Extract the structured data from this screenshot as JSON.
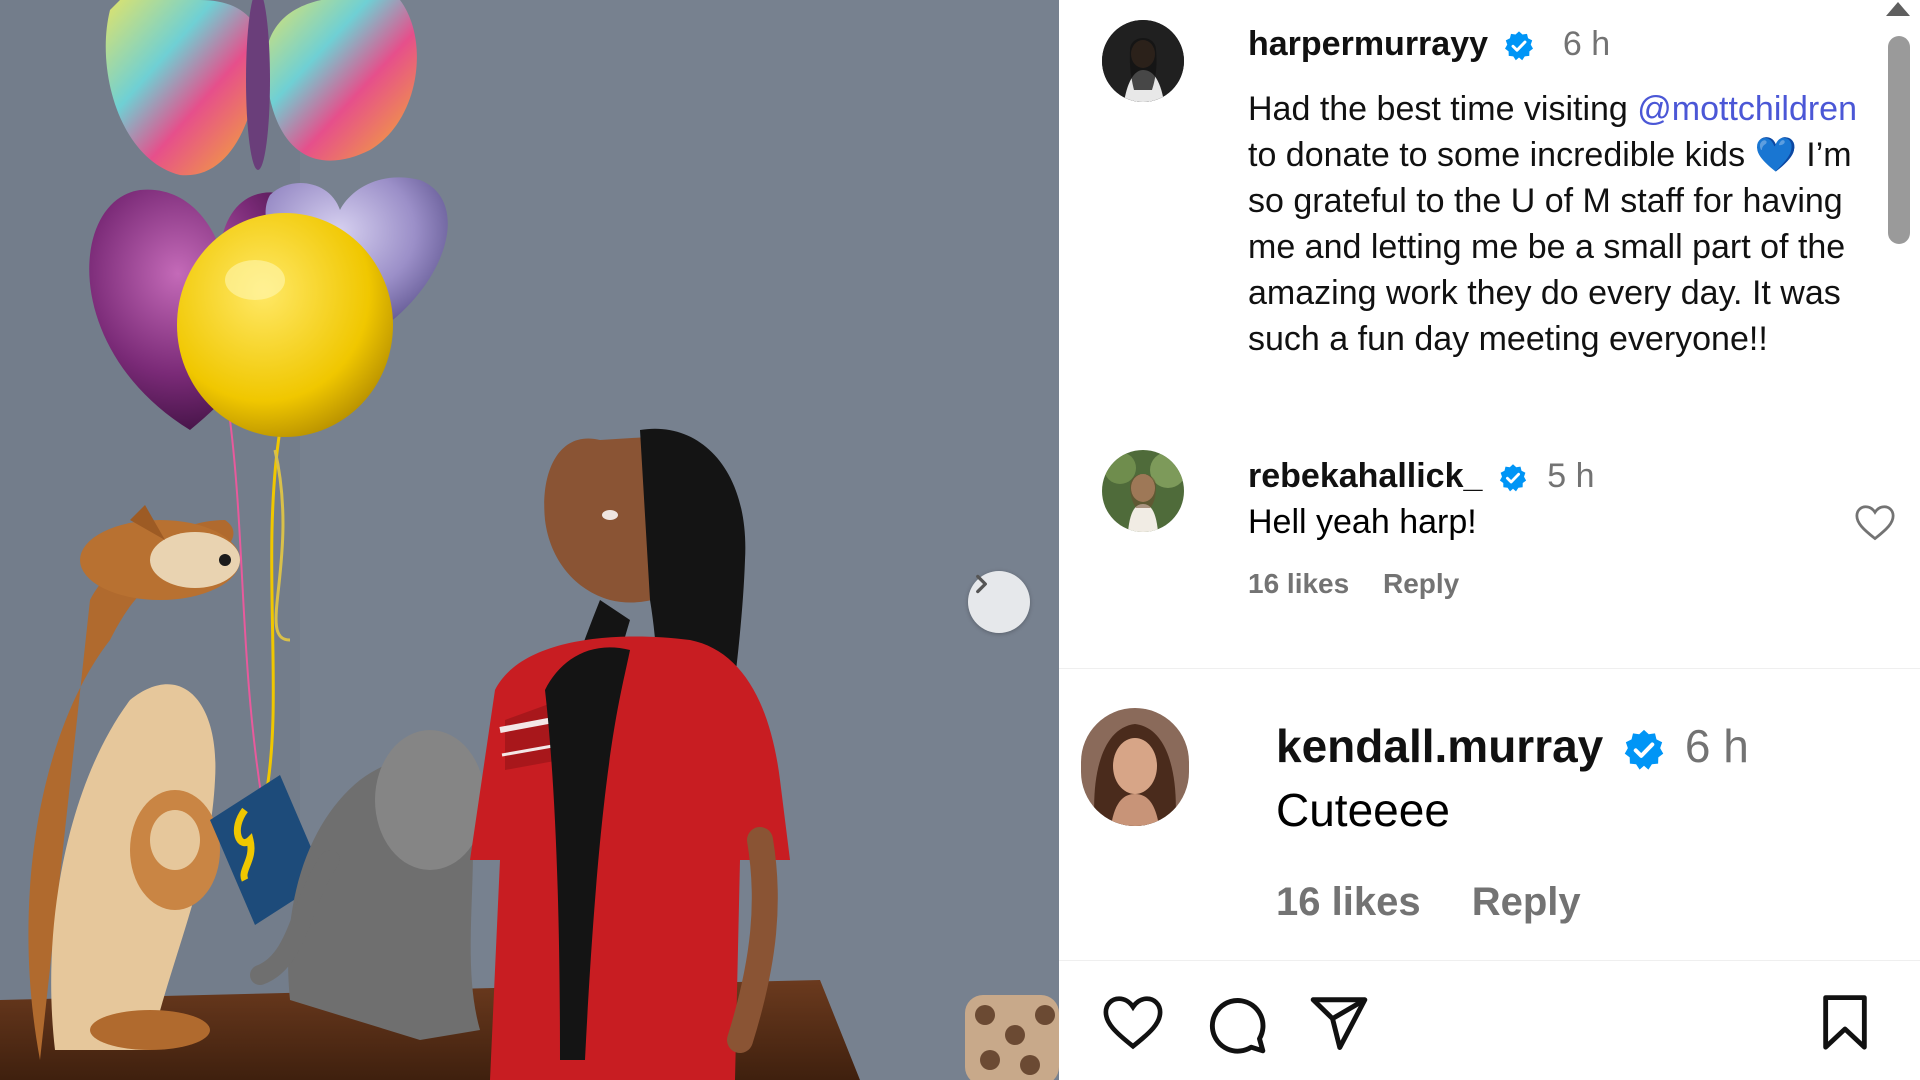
{
  "post": {
    "author": "harpermurrayy",
    "time": "6 h",
    "caption_parts": [
      "Had the best time visiting ",
      "@mottchildren",
      " to donate to some incredible kids ",
      "💙",
      " I’m so grateful to the U of M staff for having me and letting me be a small part of the amazing work they do every day. It was such a fun day meeting everyone!!"
    ]
  },
  "comments": [
    {
      "user": "rebekahallick_",
      "time": "5 h",
      "text": "Hell yeah harp!",
      "likes": "16 likes",
      "reply": "Reply"
    },
    {
      "user": "kendall.murray",
      "time": "6 h",
      "text": "Cuteeee",
      "likes": "16 likes",
      "reply": "Reply"
    }
  ],
  "icons": {
    "next": "chevron-right-icon",
    "verified": "verified-badge-icon",
    "like": "heart-icon",
    "comment": "comment-icon",
    "share": "share-icon",
    "save": "bookmark-icon"
  },
  "colors": {
    "verified": "#0095f6",
    "mention": "#4b57d6",
    "muted": "#737373"
  }
}
